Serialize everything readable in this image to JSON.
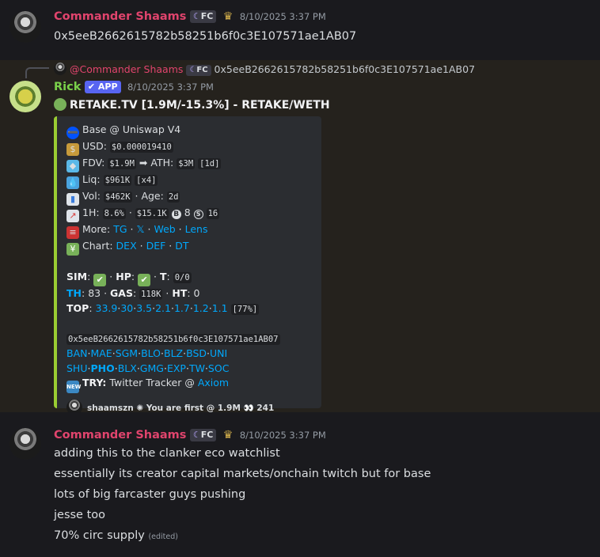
{
  "msg1": {
    "username": "Commander Shaams",
    "badge": "FC",
    "timestamp": "8/10/2025 3:37 PM",
    "text": "0x5eeB2662615782b58251b6f0c3E107571ae1AB07"
  },
  "reply": {
    "mention": "@Commander Shaams",
    "badge": "FC",
    "text": "0x5eeB2662615782b58251b6f0c3E107571ae1AB07"
  },
  "msg2": {
    "username": "Rick",
    "badge": "APP",
    "timestamp": "8/10/2025 3:37 PM",
    "title": "RETAKE.TV [1.9M/-15.3%] - RETAKE/WETH",
    "embed": {
      "pool": "Base @ Uniswap V4",
      "usd_label": "USD:",
      "usd_value": "$0.000019410",
      "fdv_label": "FDV:",
      "fdv_value": "$1.9M",
      "ath_label": "ATH:",
      "ath_value": "$3M",
      "ath_age": "[1d]",
      "liq_label": "Liq:",
      "liq_value": "$961K",
      "liq_mult": "[x4]",
      "vol_label": "Vol:",
      "vol_value": "$462K",
      "age_label": "Age:",
      "age_value": "2d",
      "h1_label": "1H:",
      "h1_pct": "8.6%",
      "h1_vol": "$15.1K",
      "h1_buys": "8",
      "h1_sells": "16",
      "more_label": "More:",
      "more_links": [
        "TG",
        "𝕏",
        "Web",
        "Lens"
      ],
      "chart_label": "Chart:",
      "chart_links": [
        "DEX",
        "DEF",
        "DT"
      ],
      "sim_label": "SIM",
      "hp_label": "HP",
      "t_label": "T",
      "t_value": "0/0",
      "th_label": "TH",
      "th_value": "83",
      "gas_label": "GAS",
      "gas_value": "118K",
      "ht_label": "HT",
      "ht_value": "0",
      "top_label": "TOP",
      "top_values": [
        "33.9",
        "30",
        "3.5",
        "2.1",
        "1.7",
        "1.2",
        "1.1"
      ],
      "top_total": "[77%]",
      "contract": "0x5eeB2662615782b58251b6f0c3E107571ae1AB07",
      "bots_row1": [
        "BAN",
        "MAE",
        "SGM",
        "BLO",
        "BLZ",
        "BSD",
        "UNI"
      ],
      "bots_row2": [
        "SHU",
        "PHO",
        "BLX",
        "GMG",
        "EXP",
        "TW",
        "SOC"
      ],
      "try_label": "TRY:",
      "try_text": "Twitter Tracker @",
      "try_link": "Axiom",
      "footer_user": "shaamszn",
      "footer_text": "You are first @ 1.9M",
      "footer_views": "241"
    }
  },
  "msg3": {
    "username": "Commander Shaams",
    "badge": "FC",
    "timestamp": "8/10/2025 3:37 PM",
    "lines": [
      "adding this to the clanker eco watchlist",
      "essentially its creator capital markets/onchain twitch but for base",
      "lots of big farcaster guys pushing",
      "jesse too",
      "70% circ supply"
    ],
    "edited": "(edited)"
  },
  "colors": {
    "background": "#1a1a1e",
    "highlight": "#25221d",
    "embed_bar": "#9acd32",
    "cmdr_name": "#e0446d",
    "rick_name": "#7ad14a",
    "link": "#00a8fc"
  }
}
